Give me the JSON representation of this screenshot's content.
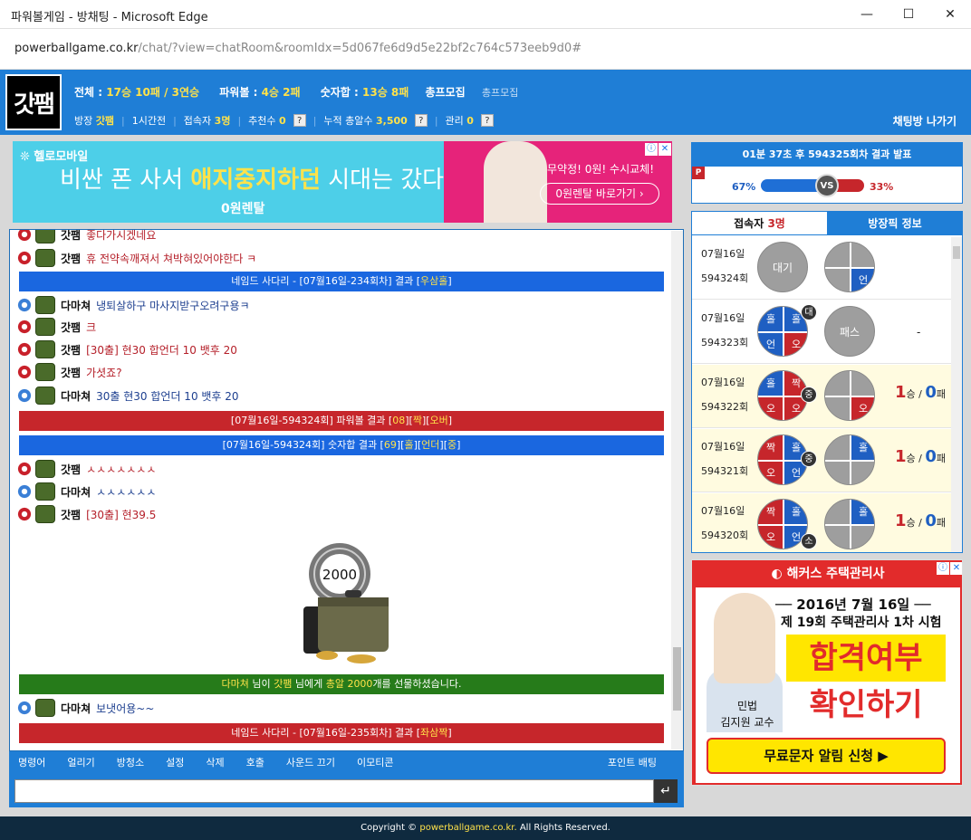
{
  "window": {
    "title": "파워볼게임 - 방채팅 - Microsoft Edge"
  },
  "address": {
    "host": "powerballgame.co.kr",
    "path": "/chat/?view=chatRoom&roomIdx=5d067fe6d9d5e22bf2c764c573eeb9d0#"
  },
  "header": {
    "logo": "갓팸",
    "stats": {
      "total_label": "전체 :",
      "total_value": "17승 10패 / 3연승",
      "powerball_label": "파워볼 :",
      "powerball_value": "4승 2패",
      "sum_label": "숫자합 :",
      "sum_value": "13승 8패",
      "recruit": "총프모집",
      "recruit_sub": "총프모집"
    },
    "info": {
      "manager_label": "방장",
      "manager": "갓팸",
      "time": "1시간전",
      "users_label": "접속자",
      "users": "3명",
      "rec_label": "추천수",
      "rec": "0",
      "bullets_label": "누적 총알수",
      "bullets": "3,500",
      "admin_label": "관리",
      "admin": "0",
      "q": "?"
    },
    "leave": "채팅방 나가기"
  },
  "ad1": {
    "brand": "헬로모바일",
    "headline_a": "비싼 폰 사서 ",
    "headline_b": "애지중지하던",
    "headline_c": " 시대는 갔다!",
    "sub": "0원렌탈",
    "promo": "무약정! 0원! 수시교체!",
    "button": "0원렌탈 바로가기 ›"
  },
  "chat": {
    "messages": [
      {
        "nick": "갓팸",
        "text": "좋다가시겠네요",
        "color": "red",
        "lv": "r"
      },
      {
        "nick": "갓팸",
        "text": "휴 전약속깨져서 쳐박혀있어야한다 ㅋ",
        "color": "red",
        "lv": "r"
      },
      {
        "nick": "다마쳐",
        "text": "냉퇴살하구 마사지받구오려구용ㅋ",
        "color": "blue",
        "lv": "b"
      },
      {
        "nick": "갓팸",
        "text": "크",
        "color": "red",
        "lv": "r"
      },
      {
        "nick": "갓팸",
        "text": "[30출] 현30  합언더 10 뱃후 20",
        "color": "red",
        "lv": "r"
      },
      {
        "nick": "갓팸",
        "text": "가셧죠?",
        "color": "red",
        "lv": "r"
      },
      {
        "nick": "다마쳐",
        "text": "30출 현30 합언더 10 뱃후 20",
        "color": "blue",
        "lv": "b"
      },
      {
        "nick": "갓팸",
        "text": "ㅅㅅㅅㅅㅅㅅㅅ",
        "color": "red",
        "lv": "r"
      },
      {
        "nick": "다마쳐",
        "text": "ㅅㅅㅅㅅㅅㅅ",
        "color": "blue",
        "lv": "b"
      },
      {
        "nick": "갓팸",
        "text": "[30출] 현39.5",
        "color": "red",
        "lv": "r"
      },
      {
        "nick": "다마쳐",
        "text": "보냇어용~~",
        "color": "blue",
        "lv": "b"
      }
    ],
    "bars": {
      "ladder1_a": "네임드 사다리 - [07월16일-234회차] 결과 [",
      "ladder1_b": "우삼홀",
      "ladder1_c": "]",
      "pb_a": "[07월16일-594324회]",
      "pb_b": " 파워볼 결과 [",
      "pb_c": "08",
      "pb_d": "][",
      "pb_e": "짝",
      "pb_f": "][",
      "pb_g": "오버",
      "pb_h": "]",
      "sum_a": "[07월16일-594324회]",
      "sum_b": " 숫자합 결과 [",
      "sum_c": "69",
      "sum_d": "][",
      "sum_e": "홀",
      "sum_f": "][",
      "sum_g": "언더",
      "sum_h": "][",
      "sum_i": "중",
      "sum_j": "]",
      "gift_a": "다마쳐",
      "gift_b": " 님이 ",
      "gift_c": "갓팸",
      "gift_d": " 님에게 ",
      "gift_e": "총알 2000",
      "gift_f": "개를 선물하셨습니다.",
      "ladder2_a": "네임드 사다리 - [07월16일-235회차] 결과 [",
      "ladder2_b": "좌삼짝",
      "ladder2_c": "]"
    },
    "gift_amount": "2000"
  },
  "toolbar": [
    "명령어",
    "얼리기",
    "방청소",
    "설정",
    "삭제",
    "호출",
    "사운드 끄기",
    "이모티콘"
  ],
  "toolbar_right": "포인트 배팅",
  "input": {
    "value": "",
    "send": "↵"
  },
  "result": {
    "header": "01분 37초 후 594325회차 결과 발표",
    "p": "P",
    "blue_pct": "67%",
    "red_pct": "33%",
    "vs": "VS",
    "blue_fraction": 0.67
  },
  "side": {
    "tab_users": "접속자 ",
    "tab_users_count": "3명",
    "tab_info": "방장픽 정보",
    "rounds": [
      {
        "date": "07월16일",
        "round": "594324회",
        "pick": "대기",
        "res": [
          "",
          "",
          "",
          "언"
        ],
        "score": null
      },
      {
        "date": "07월16일",
        "round": "594323회",
        "pick": [
          "홀",
          "홀",
          "언",
          "오"
        ],
        "badge": "대",
        "res": "패스",
        "score": "-"
      },
      {
        "date": "07월16일",
        "round": "594322회",
        "pick": [
          "홀",
          "짝",
          "오",
          "오"
        ],
        "badge": "중",
        "res": [
          "",
          "",
          "",
          "오"
        ],
        "score": {
          "w": "1",
          "wl": "승",
          "sep": " / ",
          "l": "0",
          "ll": "패"
        }
      },
      {
        "date": "07월16일",
        "round": "594321회",
        "pick": [
          "짝",
          "홀",
          "오",
          "언"
        ],
        "badge": "중",
        "res": [
          "",
          "홀",
          "",
          ""
        ],
        "score": {
          "w": "1",
          "wl": "승",
          "sep": " / ",
          "l": "0",
          "ll": "패"
        }
      },
      {
        "date": "07월16일",
        "round": "594320회",
        "pick": [
          "짝",
          "홀",
          "오",
          "언"
        ],
        "badge": "소",
        "res": [
          "",
          "홀",
          "",
          ""
        ],
        "score": {
          "w": "1",
          "wl": "승",
          "sep": " / ",
          "l": "0",
          "ll": "패"
        }
      }
    ]
  },
  "ad2": {
    "brand": "해커스 주택관리사",
    "line1": "── 2016년 7월 16일 ──",
    "line2": "제 19회 주택관리사 1차 시험",
    "line3": "합격여부",
    "line4": "확인하기",
    "cap1": "민법",
    "cap2": "김지원 교수",
    "button": "무료문자 알림 신청 ▶"
  },
  "footer": {
    "a": "Copyright © ",
    "b": "powerballgame.co.kr.",
    "c": " All Rights Reserved."
  },
  "colors": {
    "header": "#1f7ed6",
    "red": "#c6262b",
    "blue": "#1a67e0",
    "green": "#267b1a",
    "yellow": "#ffe24a"
  }
}
